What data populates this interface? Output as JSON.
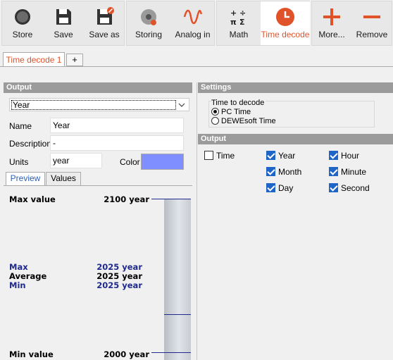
{
  "toolbar": {
    "store": "Store",
    "save": "Save",
    "save_as": "Save as",
    "storing": "Storing",
    "analog_in": "Analog in",
    "math": "Math",
    "time_decode": "Time decode",
    "more": "More...",
    "remove": "Remove",
    "accent_color": "#e0532a"
  },
  "tabs": {
    "active": "Time decode 1",
    "add": "+"
  },
  "output_panel": {
    "header": "Output",
    "selected_output": "Year",
    "name_label": "Name",
    "name_value": "Year",
    "description_label": "Description",
    "description_value": "-",
    "units_label": "Units",
    "units_value": "year",
    "color_label": "Color",
    "color_value": "#7f8fff"
  },
  "subtabs": {
    "preview": "Preview",
    "values": "Values"
  },
  "preview": {
    "max_value_label": "Max value",
    "max_value": "2100 year",
    "max_label": "Max",
    "max": "2025 year",
    "average_label": "Average",
    "average": "2025 year",
    "min_label": "Min",
    "min": "2025 year",
    "min_value_label": "Min value",
    "min_value": "2000 year",
    "current_fraction": 0.25
  },
  "settings": {
    "header": "Settings",
    "time_to_decode_label": "Time to decode",
    "options": [
      "PC Time",
      "DEWEsoft Time"
    ],
    "selected_option": "PC Time",
    "output_header": "Output",
    "outputs": [
      {
        "label": "Time",
        "checked": false
      },
      {
        "label": "Year",
        "checked": true
      },
      {
        "label": "Hour",
        "checked": true
      },
      {
        "label": "Month",
        "checked": true
      },
      {
        "label": "Minute",
        "checked": true
      },
      {
        "label": "Day",
        "checked": true
      },
      {
        "label": "Second",
        "checked": true
      }
    ]
  }
}
